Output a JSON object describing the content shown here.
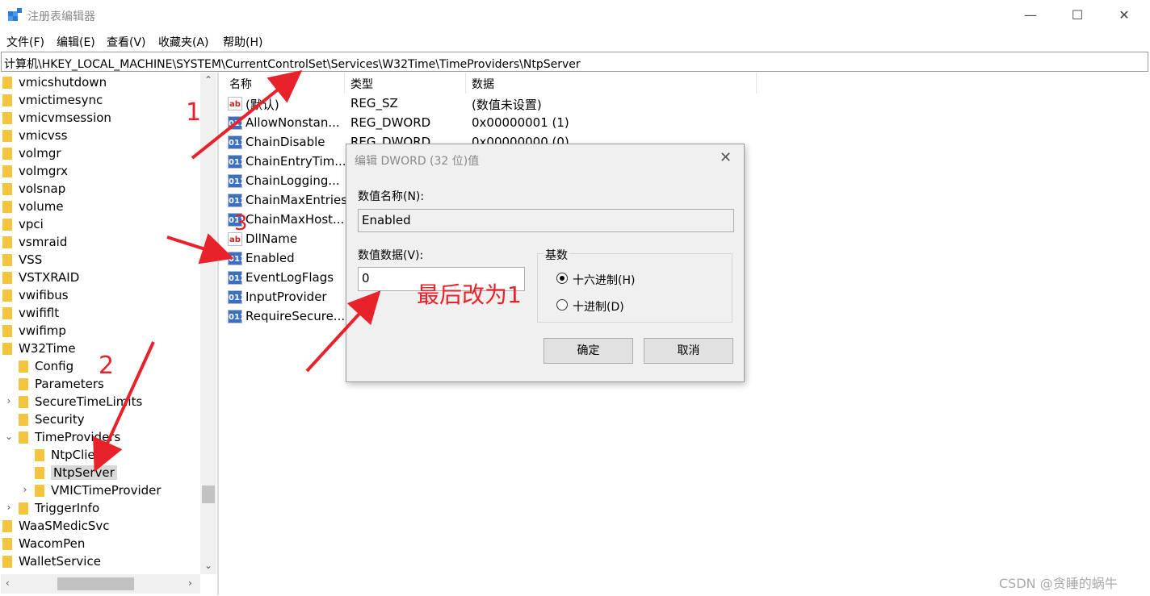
{
  "window": {
    "title": "注册表编辑器",
    "minimize": "—",
    "maximize": "☐",
    "close": "✕"
  },
  "menu": [
    "文件(F)",
    "编辑(E)",
    "查看(V)",
    "收藏夹(A)",
    "帮助(H)"
  ],
  "address": "计算机\\HKEY_LOCAL_MACHINE\\SYSTEM\\CurrentControlSet\\Services\\W32Time\\TimeProviders\\NtpServer",
  "tree": [
    {
      "label": "vmicshutdown"
    },
    {
      "label": "vmictimesync"
    },
    {
      "label": "vmicvmsession"
    },
    {
      "label": "vmicvss"
    },
    {
      "label": "volmgr"
    },
    {
      "label": "volmgrx"
    },
    {
      "label": "volsnap"
    },
    {
      "label": "volume"
    },
    {
      "label": "vpci"
    },
    {
      "label": "vsmraid"
    },
    {
      "label": "VSS"
    },
    {
      "label": "VSTXRAID"
    },
    {
      "label": "vwifibus"
    },
    {
      "label": "vwififlt"
    },
    {
      "label": "vwifimp"
    },
    {
      "label": "W32Time"
    },
    {
      "label": "Config"
    },
    {
      "label": "Parameters"
    },
    {
      "label": "SecureTimeLimits"
    },
    {
      "label": "Security"
    },
    {
      "label": "TimeProviders"
    },
    {
      "label": "NtpClient"
    },
    {
      "label": "NtpServer"
    },
    {
      "label": "VMICTimeProvider"
    },
    {
      "label": "TriggerInfo"
    },
    {
      "label": "WaaSMedicSvc"
    },
    {
      "label": "WacomPen"
    },
    {
      "label": "WalletService"
    }
  ],
  "columns": {
    "name": "名称",
    "type": "类型",
    "data": "数据"
  },
  "values": [
    {
      "name": "(默认)",
      "type": "REG_SZ",
      "data": "(数值未设置)",
      "icon": "ab"
    },
    {
      "name": "AllowNonstan...",
      "type": "REG_DWORD",
      "data": "0x00000001 (1)",
      "icon": "011"
    },
    {
      "name": "ChainDisable",
      "type": "REG_DWORD",
      "data": "0x00000000 (0)",
      "icon": "011"
    },
    {
      "name": "ChainEntryTim...",
      "type": "",
      "data": "",
      "icon": "011"
    },
    {
      "name": "ChainLogging...",
      "type": "",
      "data": "",
      "icon": "011"
    },
    {
      "name": "ChainMaxEntries",
      "type": "",
      "data": "",
      "icon": "011"
    },
    {
      "name": "ChainMaxHost...",
      "type": "",
      "data": "",
      "icon": "011"
    },
    {
      "name": "DllName",
      "type": "",
      "data": "",
      "icon": "ab"
    },
    {
      "name": "Enabled",
      "type": "",
      "data": "",
      "icon": "011"
    },
    {
      "name": "EventLogFlags",
      "type": "",
      "data": "",
      "icon": "011"
    },
    {
      "name": "InputProvider",
      "type": "",
      "data": "",
      "icon": "011"
    },
    {
      "name": "RequireSecure...",
      "type": "",
      "data": "",
      "icon": "011"
    }
  ],
  "dialog": {
    "title": "编辑 DWORD (32 位)值",
    "name_label": "数值名称(N):",
    "name_value": "Enabled",
    "data_label": "数值数据(V):",
    "data_value": "0",
    "base_label": "基数",
    "hex_label": "十六进制(H)",
    "dec_label": "十进制(D)",
    "ok": "确定",
    "cancel": "取消"
  },
  "annotations": {
    "n1": "1",
    "n2": "2",
    "n3": "3",
    "note": "最后改为1"
  },
  "watermark": "CSDN @贪睡的蜗牛",
  "colors": {
    "annotation": "#e8222b",
    "folder": "#f3c43e",
    "dword_icon": "#3a6fc4"
  }
}
